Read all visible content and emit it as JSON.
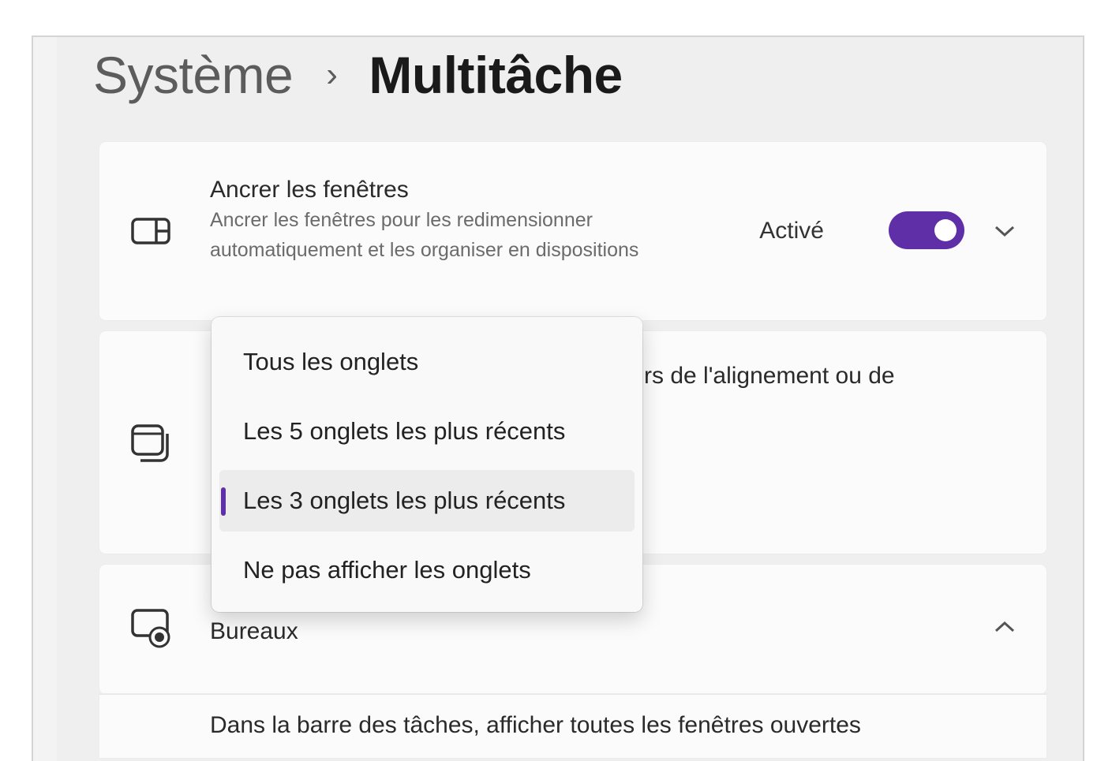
{
  "breadcrumb": {
    "parent": "Système",
    "separator": "›",
    "current": "Multitâche"
  },
  "snap_windows": {
    "icon": "snap-layout-icon",
    "title": "Ancrer les fenêtres",
    "description": "Ancrer les fenêtres pour les redimensionner automatiquement et les organiser en dispositions",
    "state_label": "Activé",
    "toggle_on": true
  },
  "alt_tab_setting": {
    "icon": "stacked-windows-icon",
    "partial_description": "rs de l'alignement ou de"
  },
  "dropdown": {
    "options": [
      "Tous les onglets",
      "Les 5 onglets les plus récents",
      "Les 3 onglets les plus récents",
      "Ne pas afficher les onglets"
    ],
    "selected_index": 2
  },
  "desktops": {
    "icon": "virtual-desktop-icon",
    "title": "Bureaux",
    "expanded": true,
    "sub_setting": "Dans la barre des tâches, afficher toutes les fenêtres ouvertes"
  },
  "colors": {
    "accent": "#5f2fa8",
    "background": "#f3f3f3",
    "card": "#fbfbfb"
  }
}
